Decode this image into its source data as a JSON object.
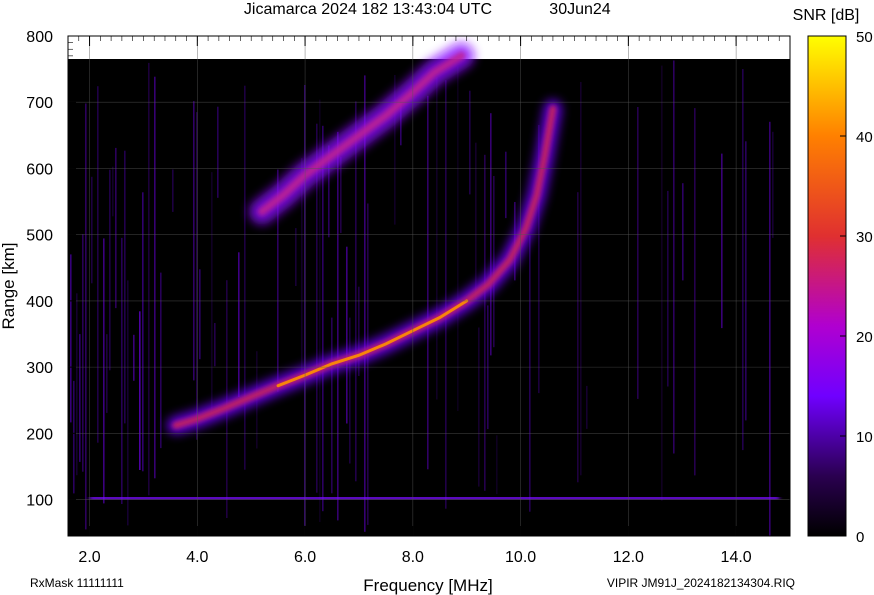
{
  "header": {
    "title": "Jicamarca 2024 182 13:43:04 UTC",
    "date": "30Jun24"
  },
  "footer": {
    "left": "RxMask 11111111",
    "right": "VIPIR  JM91J_2024182134304.RIQ"
  },
  "chart_data": {
    "type": "heatmap",
    "title": "Jicamarca 2024 182 13:43:04 UTC",
    "xlabel": "Frequency [MHz]",
    "ylabel": "Range [km]",
    "xlim": [
      1.6,
      15.0
    ],
    "ylim": [
      45,
      800
    ],
    "x_ticks": [
      2.0,
      4.0,
      6.0,
      8.0,
      10.0,
      12.0,
      14.0
    ],
    "x_tick_labels": [
      "2.0",
      "4.0",
      "6.0",
      "8.0",
      "10.0",
      "12.0",
      "14.0"
    ],
    "y_ticks": [
      100,
      200,
      300,
      400,
      500,
      600,
      700,
      800
    ],
    "y_tick_labels": [
      "100",
      "200",
      "300",
      "400",
      "500",
      "600",
      "700",
      "800"
    ],
    "grid": true,
    "colorbar": {
      "label": "SNR [dB]",
      "range": [
        0,
        50
      ],
      "ticks": [
        0,
        10,
        20,
        30,
        40,
        50
      ],
      "tick_labels": [
        "0",
        "10",
        "20",
        "30",
        "40",
        "50"
      ],
      "colors": [
        "#000000",
        "#2a0050",
        "#7000ff",
        "#b000d0",
        "#e03030",
        "#ff8000",
        "#ffff00"
      ]
    },
    "traces": [
      {
        "name": "",
        "points": [
          [
            3.6,
            212
          ],
          [
            4.0,
            222
          ],
          [
            4.5,
            238
          ],
          [
            5.0,
            255
          ],
          [
            5.5,
            272
          ],
          [
            6.0,
            288
          ],
          [
            6.5,
            305
          ],
          [
            7.0,
            318
          ],
          [
            7.5,
            335
          ],
          [
            8.0,
            355
          ],
          [
            8.5,
            375
          ],
          [
            9.0,
            400
          ],
          [
            9.4,
            425
          ],
          [
            9.8,
            462
          ],
          [
            10.1,
            510
          ],
          [
            10.3,
            560
          ],
          [
            10.45,
            620
          ],
          [
            10.6,
            690
          ]
        ],
        "snr_db": 38
      },
      {
        "name": "",
        "points": [
          [
            5.2,
            535
          ],
          [
            5.6,
            560
          ],
          [
            6.0,
            590
          ],
          [
            6.5,
            620
          ],
          [
            7.0,
            650
          ],
          [
            7.5,
            680
          ],
          [
            8.0,
            715
          ],
          [
            8.4,
            745
          ],
          [
            8.9,
            770
          ]
        ],
        "snr_db": 28
      },
      {
        "name": "",
        "points": [
          [
            2.0,
            102
          ],
          [
            4.0,
            103
          ],
          [
            6.0,
            102
          ],
          [
            8.0,
            101
          ],
          [
            9.5,
            101
          ],
          [
            10.0,
            101
          ],
          [
            11.5,
            101
          ],
          [
            12.3,
            101
          ],
          [
            13.5,
            101
          ],
          [
            14.8,
            101
          ]
        ],
        "snr_db": 15
      }
    ]
  }
}
